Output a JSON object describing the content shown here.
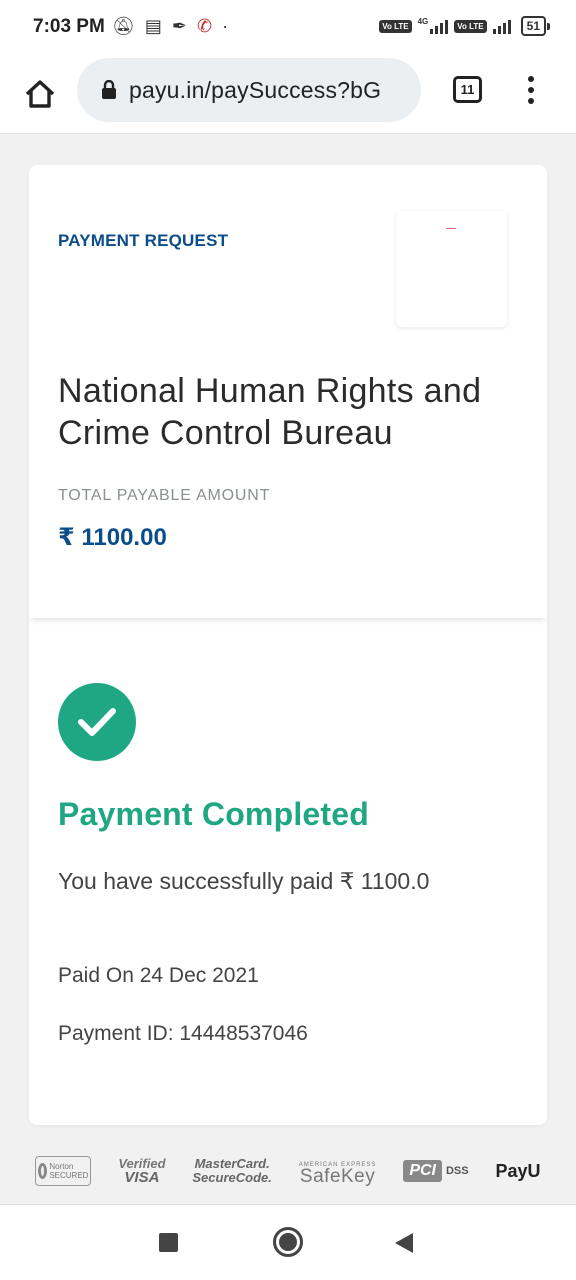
{
  "status_bar": {
    "time": "7:03 PM",
    "left_icons": [
      "muted-bell-icon",
      "message-icon",
      "app-icon",
      "missed-call-icon",
      "dot-icon"
    ],
    "network_gen": "4G",
    "sim1_label": "Vo LTE",
    "sim2_label": "Vo LTE",
    "battery": "51"
  },
  "browser": {
    "url": "payu.in/paySuccess?bG",
    "tab_count": "11"
  },
  "payment_request": {
    "label": "PAYMENT REQUEST",
    "merchant_name": "National Human Rights and Crime Control Bureau",
    "amount_label": "TOTAL PAYABLE AMOUNT",
    "amount": "₹ 1100.00"
  },
  "payment_status": {
    "title": "Payment Completed",
    "message": "You have successfully paid ₹ 1100.0",
    "paid_on": "Paid On 24 Dec 2021",
    "payment_id": "Payment ID: 14448537046"
  },
  "badges": {
    "norton": "Norton SECURED",
    "verified_line1": "Verified",
    "verified_line2": "VISA",
    "mastercard_line1": "MasterCard.",
    "mastercard_line2": "SecureCode.",
    "amex_line1": "AMERICAN EXPRESS",
    "amex_line2": "SafeKey",
    "pci": "PCI",
    "dss": "DSS",
    "payu": "PayU"
  },
  "colors": {
    "brand_blue": "#0b4d8a",
    "success_green": "#1fa783",
    "background": "#f1f1f1"
  }
}
